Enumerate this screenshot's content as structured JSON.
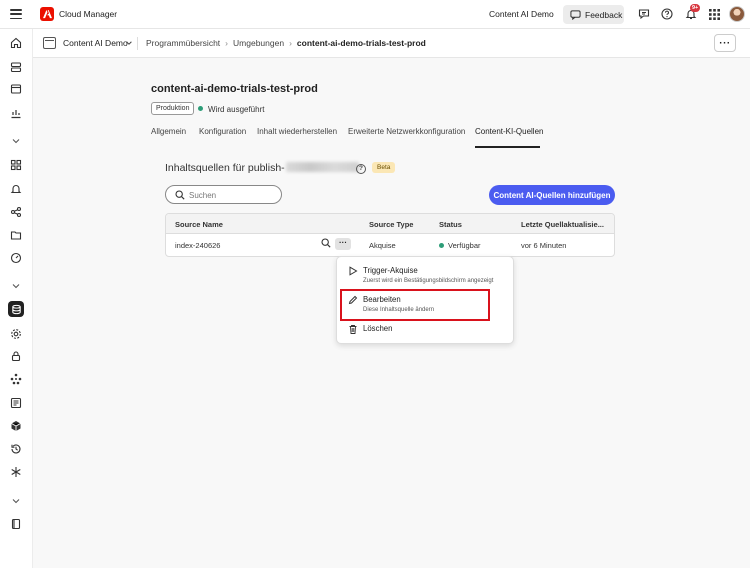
{
  "topbar": {
    "app_title": "Cloud Manager",
    "org_name": "Content AI Demo",
    "feedback_label": "Feedback",
    "notification_count": "9+"
  },
  "subbar": {
    "program_name": "Content AI Demo",
    "breadcrumbs": [
      "Programmübersicht",
      "Umgebungen",
      "content-ai-demo-trials-test-prod"
    ]
  },
  "environment": {
    "title": "content-ai-demo-trials-test-prod",
    "badge": "Produktion",
    "status": "Wird ausgeführt"
  },
  "tabs": [
    {
      "label": "Allgemein"
    },
    {
      "label": "Konfiguration"
    },
    {
      "label": "Inhalt wiederherstellen"
    },
    {
      "label": "Erweiterte Netzwerkkonfiguration"
    },
    {
      "label": "Content-KI-Quellen"
    }
  ],
  "sources": {
    "heading": "Inhaltsquellen für publish-",
    "beta_label": "Beta",
    "search_placeholder": "Suchen",
    "add_button": "Content AI-Quellen hinzufügen",
    "columns": [
      "Source Name",
      "Source Type",
      "Status",
      "Letzte Quellaktualisie..."
    ],
    "rows": [
      {
        "name": "index-240626",
        "type": "Akquise",
        "status": "Verfügbar",
        "updated": "vor 6 Minuten"
      }
    ]
  },
  "context_menu": {
    "items": [
      {
        "label": "Trigger-Akquise",
        "desc": "Zuerst wird ein Bestätigungsbildschirm angezeigt"
      },
      {
        "label": "Bearbeiten",
        "desc": "Diese Inhaltsquelle ändern"
      },
      {
        "label": "Löschen"
      }
    ]
  },
  "colors": {
    "accent": "#4b5cf0",
    "status_ok": "#2d9d78",
    "adobe_red": "#eb1000",
    "highlight": "#d9121c"
  }
}
